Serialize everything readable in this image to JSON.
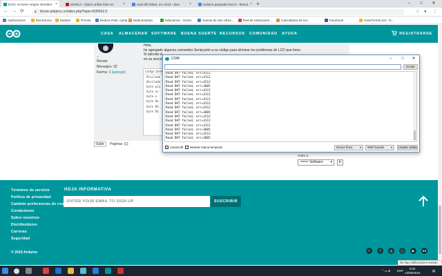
{
  "browser": {
    "tabs": [
      {
        "label": "Error: no tiene ningún miembro",
        "fav": "#00979c"
      },
      {
        "label": "MARCA - Diario online líder en",
        "fav": "#c4161c"
      },
      {
        "label": "read dht failed, err=4112 - Bus",
        "fav": "#4285f4"
      },
      {
        "label": "arduino parpadeo led rx - Busca",
        "fav": "#4285f4"
      }
    ],
    "new_tab": "+",
    "window_controls": [
      "–",
      "□",
      "✕"
    ],
    "url": "forum.arduino.cc/index.php?topic=635662.0",
    "bookmarks": [
      {
        "label": "Aplicaciones",
        "color": "#4a7bd0"
      },
      {
        "label": "Electrónica",
        "color": "#f2b600"
      },
      {
        "label": "Mufase",
        "color": "#f2b600"
      },
      {
        "label": "Prensa",
        "color": "#f2b600"
      },
      {
        "label": "Bedura Park, camp...",
        "color": "#4a7bd0"
      },
      {
        "label": "Webcampista",
        "color": "#e88b2d"
      },
      {
        "label": "Educamos - Home",
        "color": "#3b9a3b"
      },
      {
        "label": "Sumas de dos cifras...",
        "color": "#4a7bd0"
      },
      {
        "label": "Red de estaciones...",
        "color": "#c44"
      },
      {
        "label": "Calculadora de lev...",
        "color": "#e88b2d"
      },
      {
        "label": "Facebook",
        "color": "#3b5998"
      },
      {
        "label": "GranTorrent.net - D...",
        "color": "#f2b600"
      }
    ]
  },
  "nav": {
    "items": [
      "CASA",
      "ALMACENAR",
      "SOFTWARE",
      "BUENA SUERTE",
      "RECURSOS",
      "COMUNIDAD",
      "AYUDA"
    ],
    "signin": "REGISTRARSE"
  },
  "forum": {
    "user": {
      "status": "Novato",
      "messages": "Mensajes: 32",
      "karma_label": "Karma: 1",
      "karma_link": "[agregar]",
      "gender": "♀"
    },
    "post_lines": [
      "Hola,",
      "he agregado algunos comandos Serial.print a su código para eliminar los problemas de LCD que tiene.",
      "Si ejecuta el",
      "en su secció"
    ],
    "code_header": "Código: [Selec",
    "code_lines": [
      "#include",
      "#include",
      "",
      "byte pin",
      "byte ei",
      "byte e ",
      "byte De",
      "byte DS",
      "byte DS"
    ],
    "pager_button": "Subir",
    "pager_label": "Páginas: [1]",
    "jump_label": "Salta a:",
    "jump_value": "===> Software",
    "jump_go": "Ir"
  },
  "serial_monitor": {
    "title": "COM",
    "send_label": "Enviar",
    "input_value": "",
    "lines": [
      "Read DHT failed, err=4112",
      "Read DHT failed, err=4112",
      "Read DHT failed, err=4112",
      "Read DHT failed, err=3005",
      "Read DHT failed, err=4112",
      "Read DHT failed, err=4112",
      "Read DHT failed, err=4112",
      "Read DHT failed, err=4112",
      "Read DHT failed, err=4112",
      "Read DHT failed, err=3005",
      "Read DHT failed, err=4112",
      "Read DHT failed, err=4112",
      "Read DHT failed, err=4112",
      "Read DHT failed, err=3005",
      "Read DHT failed, err=4112",
      "Read DHT failed, err=3005"
    ],
    "autoscroll_label": "Autoscroll",
    "autoscroll_checked": true,
    "timestamp_label": "Mostrar marca temporal",
    "timestamp_checked": false,
    "line_ending": "Nueva línea",
    "baud": "9600 baudio",
    "clear_label": "Limpiar salida"
  },
  "footer": {
    "links": [
      "Términos de servicio",
      "Política de privacidad",
      "Cambiar preferencias de cook",
      "Contáctenos",
      "Sobre nosotros",
      "Distribuidores",
      "Carreras",
      "Seguridad"
    ],
    "newsletter_heading": "HOJA INFORMATIVA",
    "email_placeholder": "ENTER YOUR EMAIL TO SIGN UP",
    "subscribe_label": "SUSCRIBIR",
    "copyright": "© 2019 Arduino",
    "social": [
      "t",
      "f",
      "◎",
      "◯",
      "▶",
      "●●",
      "✉"
    ]
  },
  "toast": "No hay notificaciones nuevas",
  "taskbar": {
    "lang": "ESP",
    "time": "0:00",
    "date": "13/09/2019"
  }
}
